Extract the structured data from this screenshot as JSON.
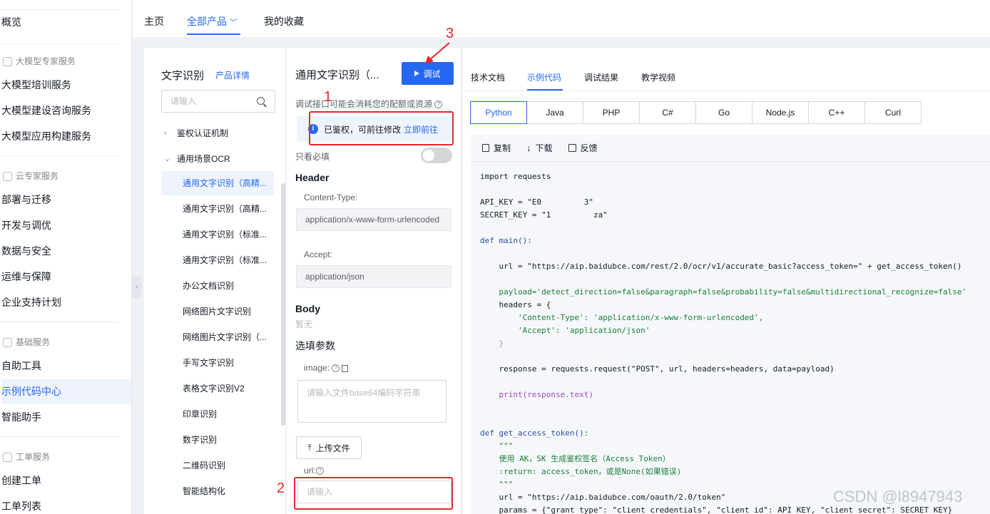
{
  "sidebar": {
    "items": [
      {
        "label": "概览"
      },
      {
        "label": "大模型培训服务"
      },
      {
        "label": "大模型建设咨询服务"
      },
      {
        "label": "大模型应用构建服务"
      },
      {
        "label": "部署与迁移"
      },
      {
        "label": "开发与调优"
      },
      {
        "label": "数据与安全"
      },
      {
        "label": "运维与保障"
      },
      {
        "label": "企业支持计划"
      },
      {
        "label": "自助工具"
      },
      {
        "label": "示例代码中心"
      },
      {
        "label": "智能助手"
      },
      {
        "label": "创建工单"
      },
      {
        "label": "工单列表"
      }
    ],
    "groups": [
      {
        "label": "大模型专家服务"
      },
      {
        "label": "云专家服务"
      },
      {
        "label": "基础服务"
      },
      {
        "label": "工单服务"
      }
    ]
  },
  "topnav": {
    "tabs": [
      {
        "label": "主页"
      },
      {
        "label": "全部产品"
      },
      {
        "label": "我的收藏"
      }
    ]
  },
  "product_tree": {
    "title": "文字识别",
    "detail_link": "产品详情",
    "search_placeholder": "请输入",
    "categories": [
      {
        "label": "鉴权认证机制"
      },
      {
        "label": "通用场景OCR"
      }
    ],
    "items": [
      {
        "label": "通用文字识别（高精..."
      },
      {
        "label": "通用文字识别（高精..."
      },
      {
        "label": "通用文字识别（标准..."
      },
      {
        "label": "通用文字识别（标准..."
      },
      {
        "label": "办公文档识别"
      },
      {
        "label": "网络图片文字识别"
      },
      {
        "label": "网络图片文字识别（..."
      },
      {
        "label": "手写文字识别"
      },
      {
        "label": "表格文字识别V2"
      },
      {
        "label": "印章识别"
      },
      {
        "label": "数字识别"
      },
      {
        "label": "二维码识别"
      },
      {
        "label": "智能结构化"
      }
    ]
  },
  "api_panel": {
    "title": "通用文字识别（...",
    "debug_button": "调试",
    "warning": "调试接口可能会消耗您的配额或资源",
    "auth_text": "已鉴权，可前往修改",
    "auth_link": "立即前往",
    "required_only": "只看必填",
    "header_section": "Header",
    "content_type_label": "Content-Type:",
    "content_type_value": "application/x-www-form-urlencoded",
    "accept_label": "Accept:",
    "accept_value": "application/json",
    "body_section": "Body",
    "body_empty": "暂无",
    "optional_section": "选填参数",
    "image_label": "image:",
    "image_placeholder": "请输入文件base64编码字符串",
    "upload_button": "上传文件",
    "url_label": "url:",
    "url_placeholder": "请输入"
  },
  "annotations": [
    "1",
    "2",
    "3"
  ],
  "code_panel": {
    "tabs": [
      {
        "label": "技术文档"
      },
      {
        "label": "示例代码"
      },
      {
        "label": "调试结果"
      },
      {
        "label": "教学视频"
      }
    ],
    "languages": [
      {
        "label": "Python"
      },
      {
        "label": "Java"
      },
      {
        "label": "PHP"
      },
      {
        "label": "C#"
      },
      {
        "label": "Go"
      },
      {
        "label": "Node.js"
      },
      {
        "label": "C++"
      },
      {
        "label": "Curl"
      }
    ],
    "tools": {
      "copy": "复制",
      "download": "下载",
      "feedback": "反馈"
    },
    "code": {
      "l1": "import requests",
      "l2": "API_KEY = \"E0         3\"",
      "l3": "SECRET_KEY = \"1         za\"",
      "l4": "def main():",
      "l5": "    url = \"https://aip.baidubce.com/rest/2.0/ocr/v1/accurate_basic?access_token=\" + get_access_token()",
      "l6": "    payload='detect_direction=false&paragraph=false&probability=false&multidirectional_recognize=false'",
      "l7": "    headers = {",
      "l8": "        'Content-Type': 'application/x-www-form-urlencoded',",
      "l9": "        'Accept': 'application/json'",
      "l10": "    }",
      "l11": "    response = requests.request(\"POST\", url, headers=headers, data=payload)",
      "l12": "    print(response.text)",
      "l13": "def get_access_token():",
      "l14": "    \"\"\"",
      "l15": "    使用 AK，SK 生成鉴权签名（Access Token）",
      "l16": "    :return: access_token，或是None(如果错误)",
      "l17": "    \"\"\"",
      "l18": "    url = \"https://aip.baidubce.com/oauth/2.0/token\"",
      "l19": "    params = {\"grant_type\": \"client_credentials\", \"client_id\": API_KEY, \"client_secret\": SECRET_KEY}"
    }
  },
  "watermark": "CSDN @l8947943"
}
